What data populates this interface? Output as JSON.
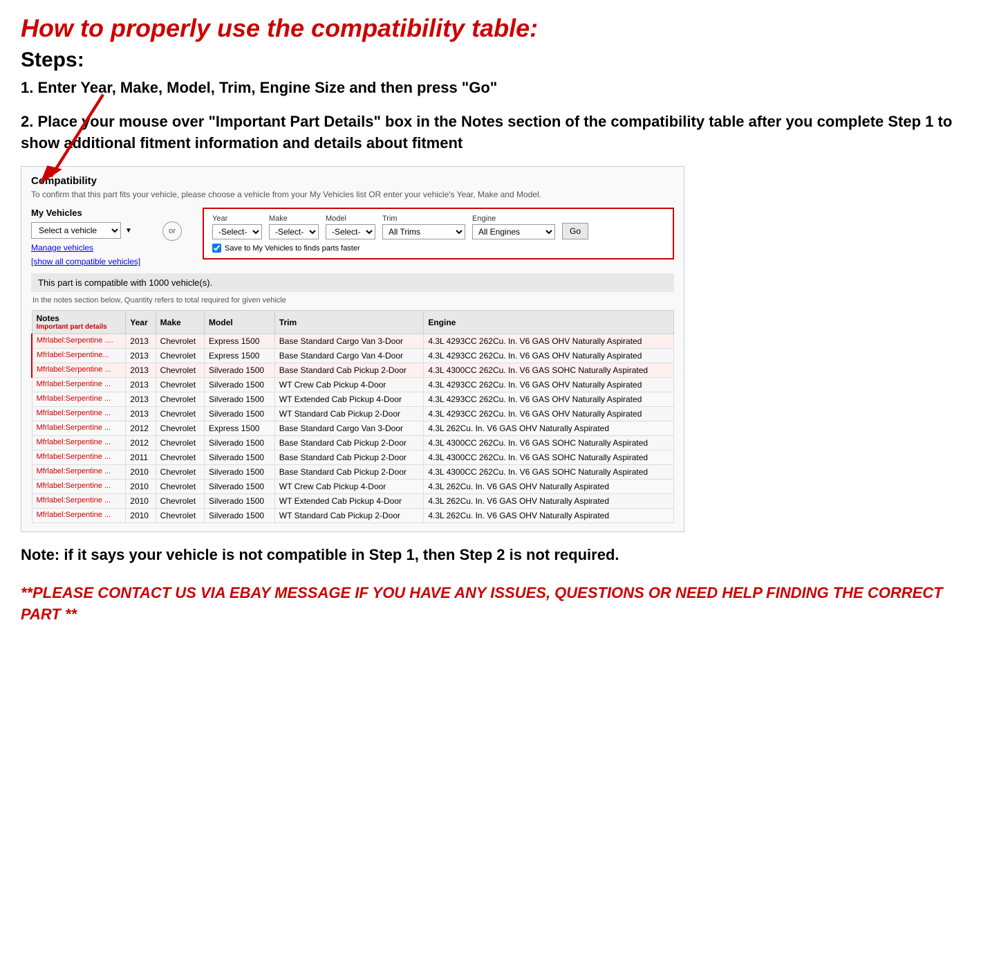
{
  "title": "How to properly use the compatibility table:",
  "steps_title": "Steps:",
  "step1": "1. Enter Year, Make, Model, Trim, Engine Size and then press \"Go\"",
  "step2": "2. Place your mouse over \"Important Part Details\" box in the Notes section of the compatibility table after you complete Step 1 to show additional fitment information and details about fitment",
  "compatibility": {
    "title": "Compatibility",
    "subtitle": "To confirm that this part fits your vehicle, please choose a vehicle from your My Vehicles list OR enter your vehicle's Year, Make and Model.",
    "my_vehicles_label": "My Vehicles",
    "select_vehicle_placeholder": "Select a vehicle",
    "manage_vehicles": "Manage vehicles",
    "show_compatible": "[show all compatible vehicles]",
    "or_label": "or",
    "fields": {
      "year_label": "Year",
      "year_value": "-Select-",
      "make_label": "Make",
      "make_value": "-Select-",
      "model_label": "Model",
      "model_value": "-Select-",
      "trim_label": "Trim",
      "trim_value": "All Trims",
      "engine_label": "Engine",
      "engine_value": "All Engines",
      "go_label": "Go"
    },
    "save_checkbox_text": "Save to My Vehicles to finds parts faster",
    "compatible_count": "This part is compatible with 1000 vehicle(s).",
    "quantity_note": "In the notes section below, Quantity refers to total required for given vehicle",
    "table": {
      "headers": [
        "Notes",
        "Year",
        "Make",
        "Model",
        "Trim",
        "Engine"
      ],
      "notes_sub": "Important part details",
      "rows": [
        {
          "notes": "Mfrlabel:Serpentine ....",
          "year": "2013",
          "make": "Chevrolet",
          "model": "Express 1500",
          "trim": "Base Standard Cargo Van 3-Door",
          "engine": "4.3L 4293CC 262Cu. In. V6 GAS OHV Naturally Aspirated",
          "highlight": true
        },
        {
          "notes": "Mfrlabel:Serpentine...",
          "year": "2013",
          "make": "Chevrolet",
          "model": "Express 1500",
          "trim": "Base Standard Cargo Van 4-Door",
          "engine": "4.3L 4293CC 262Cu. In. V6 GAS OHV Naturally Aspirated",
          "highlight": true
        },
        {
          "notes": "Mfrlabel:Serpentine ...",
          "year": "2013",
          "make": "Chevrolet",
          "model": "Silverado 1500",
          "trim": "Base Standard Cab Pickup 2-Door",
          "engine": "4.3L 4300CC 262Cu. In. V6 GAS SOHC Naturally Aspirated",
          "highlight": true
        },
        {
          "notes": "Mfrlabel:Serpentine ...",
          "year": "2013",
          "make": "Chevrolet",
          "model": "Silverado 1500",
          "trim": "WT Crew Cab Pickup 4-Door",
          "engine": "4.3L 4293CC 262Cu. In. V6 GAS OHV Naturally Aspirated",
          "highlight": false
        },
        {
          "notes": "Mfrlabel:Serpentine ...",
          "year": "2013",
          "make": "Chevrolet",
          "model": "Silverado 1500",
          "trim": "WT Extended Cab Pickup 4-Door",
          "engine": "4.3L 4293CC 262Cu. In. V6 GAS OHV Naturally Aspirated",
          "highlight": false
        },
        {
          "notes": "Mfrlabel:Serpentine ...",
          "year": "2013",
          "make": "Chevrolet",
          "model": "Silverado 1500",
          "trim": "WT Standard Cab Pickup 2-Door",
          "engine": "4.3L 4293CC 262Cu. In. V6 GAS OHV Naturally Aspirated",
          "highlight": false
        },
        {
          "notes": "Mfrlabel:Serpentine ...",
          "year": "2012",
          "make": "Chevrolet",
          "model": "Express 1500",
          "trim": "Base Standard Cargo Van 3-Door",
          "engine": "4.3L 262Cu. In. V6 GAS OHV Naturally Aspirated",
          "highlight": false
        },
        {
          "notes": "Mfrlabel:Serpentine ...",
          "year": "2012",
          "make": "Chevrolet",
          "model": "Silverado 1500",
          "trim": "Base Standard Cab Pickup 2-Door",
          "engine": "4.3L 4300CC 262Cu. In. V6 GAS SOHC Naturally Aspirated",
          "highlight": false
        },
        {
          "notes": "Mfrlabel:Serpentine ...",
          "year": "2011",
          "make": "Chevrolet",
          "model": "Silverado 1500",
          "trim": "Base Standard Cab Pickup 2-Door",
          "engine": "4.3L 4300CC 262Cu. In. V6 GAS SOHC Naturally Aspirated",
          "highlight": false
        },
        {
          "notes": "Mfrlabel:Serpentine ...",
          "year": "2010",
          "make": "Chevrolet",
          "model": "Silverado 1500",
          "trim": "Base Standard Cab Pickup 2-Door",
          "engine": "4.3L 4300CC 262Cu. In. V6 GAS SOHC Naturally Aspirated",
          "highlight": false
        },
        {
          "notes": "Mfrlabel:Serpentine ...",
          "year": "2010",
          "make": "Chevrolet",
          "model": "Silverado 1500",
          "trim": "WT Crew Cab Pickup 4-Door",
          "engine": "4.3L 262Cu. In. V6 GAS OHV Naturally Aspirated",
          "highlight": false
        },
        {
          "notes": "Mfrlabel:Serpentine ...",
          "year": "2010",
          "make": "Chevrolet",
          "model": "Silverado 1500",
          "trim": "WT Extended Cab Pickup 4-Door",
          "engine": "4.3L 262Cu. In. V6 GAS OHV Naturally Aspirated",
          "highlight": false
        },
        {
          "notes": "Mfrlabel:Serpentine ...",
          "year": "2010",
          "make": "Chevrolet",
          "model": "Silverado 1500",
          "trim": "WT Standard Cab Pickup 2-Door",
          "engine": "4.3L 262Cu. In. V6 GAS OHV Naturally Aspirated",
          "highlight": false
        }
      ]
    }
  },
  "note_text": "Note: if it says your vehicle is not compatible in Step 1, then Step 2 is not required.",
  "contact_text": "**PLEASE CONTACT US VIA EBAY MESSAGE IF YOU HAVE ANY ISSUES, QUESTIONS OR NEED HELP FINDING THE CORRECT PART **"
}
